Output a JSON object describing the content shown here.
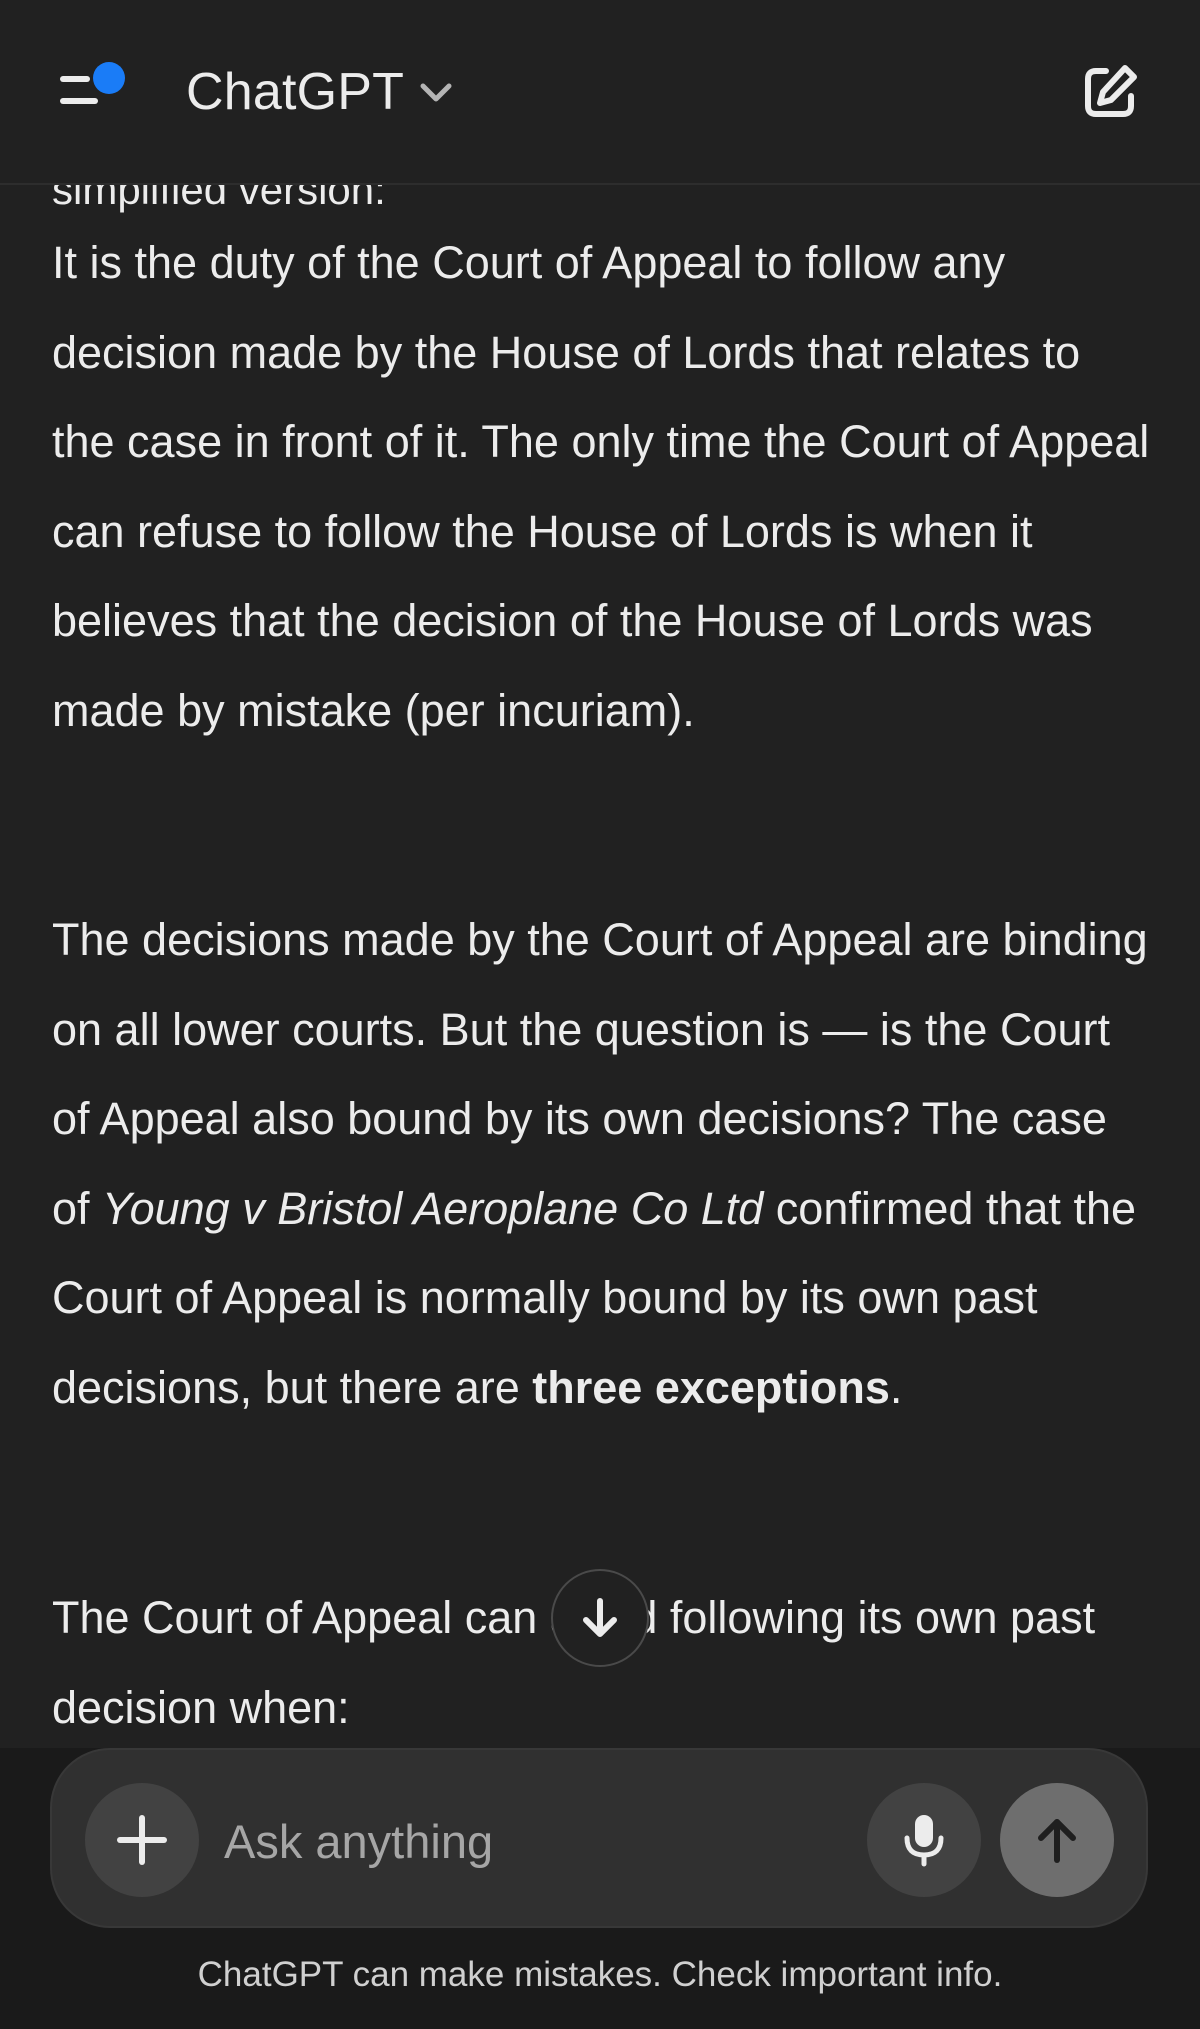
{
  "header": {
    "title": "ChatGPT",
    "menu_icon": "sidebar-menu-icon",
    "notification_dot_color": "#1a7cf7",
    "new_chat_icon": "new-chat-edit-icon"
  },
  "message": {
    "cut_off_line": "simplified version:",
    "para1": "It is the duty of the Court of Appeal to follow any decision made by the House of Lords that relates to the case in front of it. The only time the Court of Appeal can refuse to follow the House of Lords is when it believes that the decision of the House of Lords was made by mistake (per incuriam).",
    "para2_part1": "The decisions made by the Court of Appeal are binding on all lower courts. But the question is — is the Court of Appeal also bound by its own decisions? The case of ",
    "para2_case_name": "Young v Bristol Aeroplane Co Ltd",
    "para2_part2": " confirmed that the Court of Appeal is normally bound by its own past decisions, but there are ",
    "para2_bold": "three exceptions",
    "para2_end": ".",
    "para3": "The Court of Appeal can avoid following its own past decision when:"
  },
  "scroll_button": {
    "icon": "arrow-down-icon"
  },
  "composer": {
    "placeholder": "Ask anything",
    "plus_icon": "plus-icon",
    "mic_icon": "microphone-icon",
    "send_icon": "arrow-up-icon"
  },
  "footer": {
    "disclaimer": "ChatGPT can make mistakes. Check important info."
  },
  "colors": {
    "background": "#212121",
    "text": "#ececec",
    "composer_bg": "#303030",
    "accent_blue": "#1a7cf7"
  }
}
